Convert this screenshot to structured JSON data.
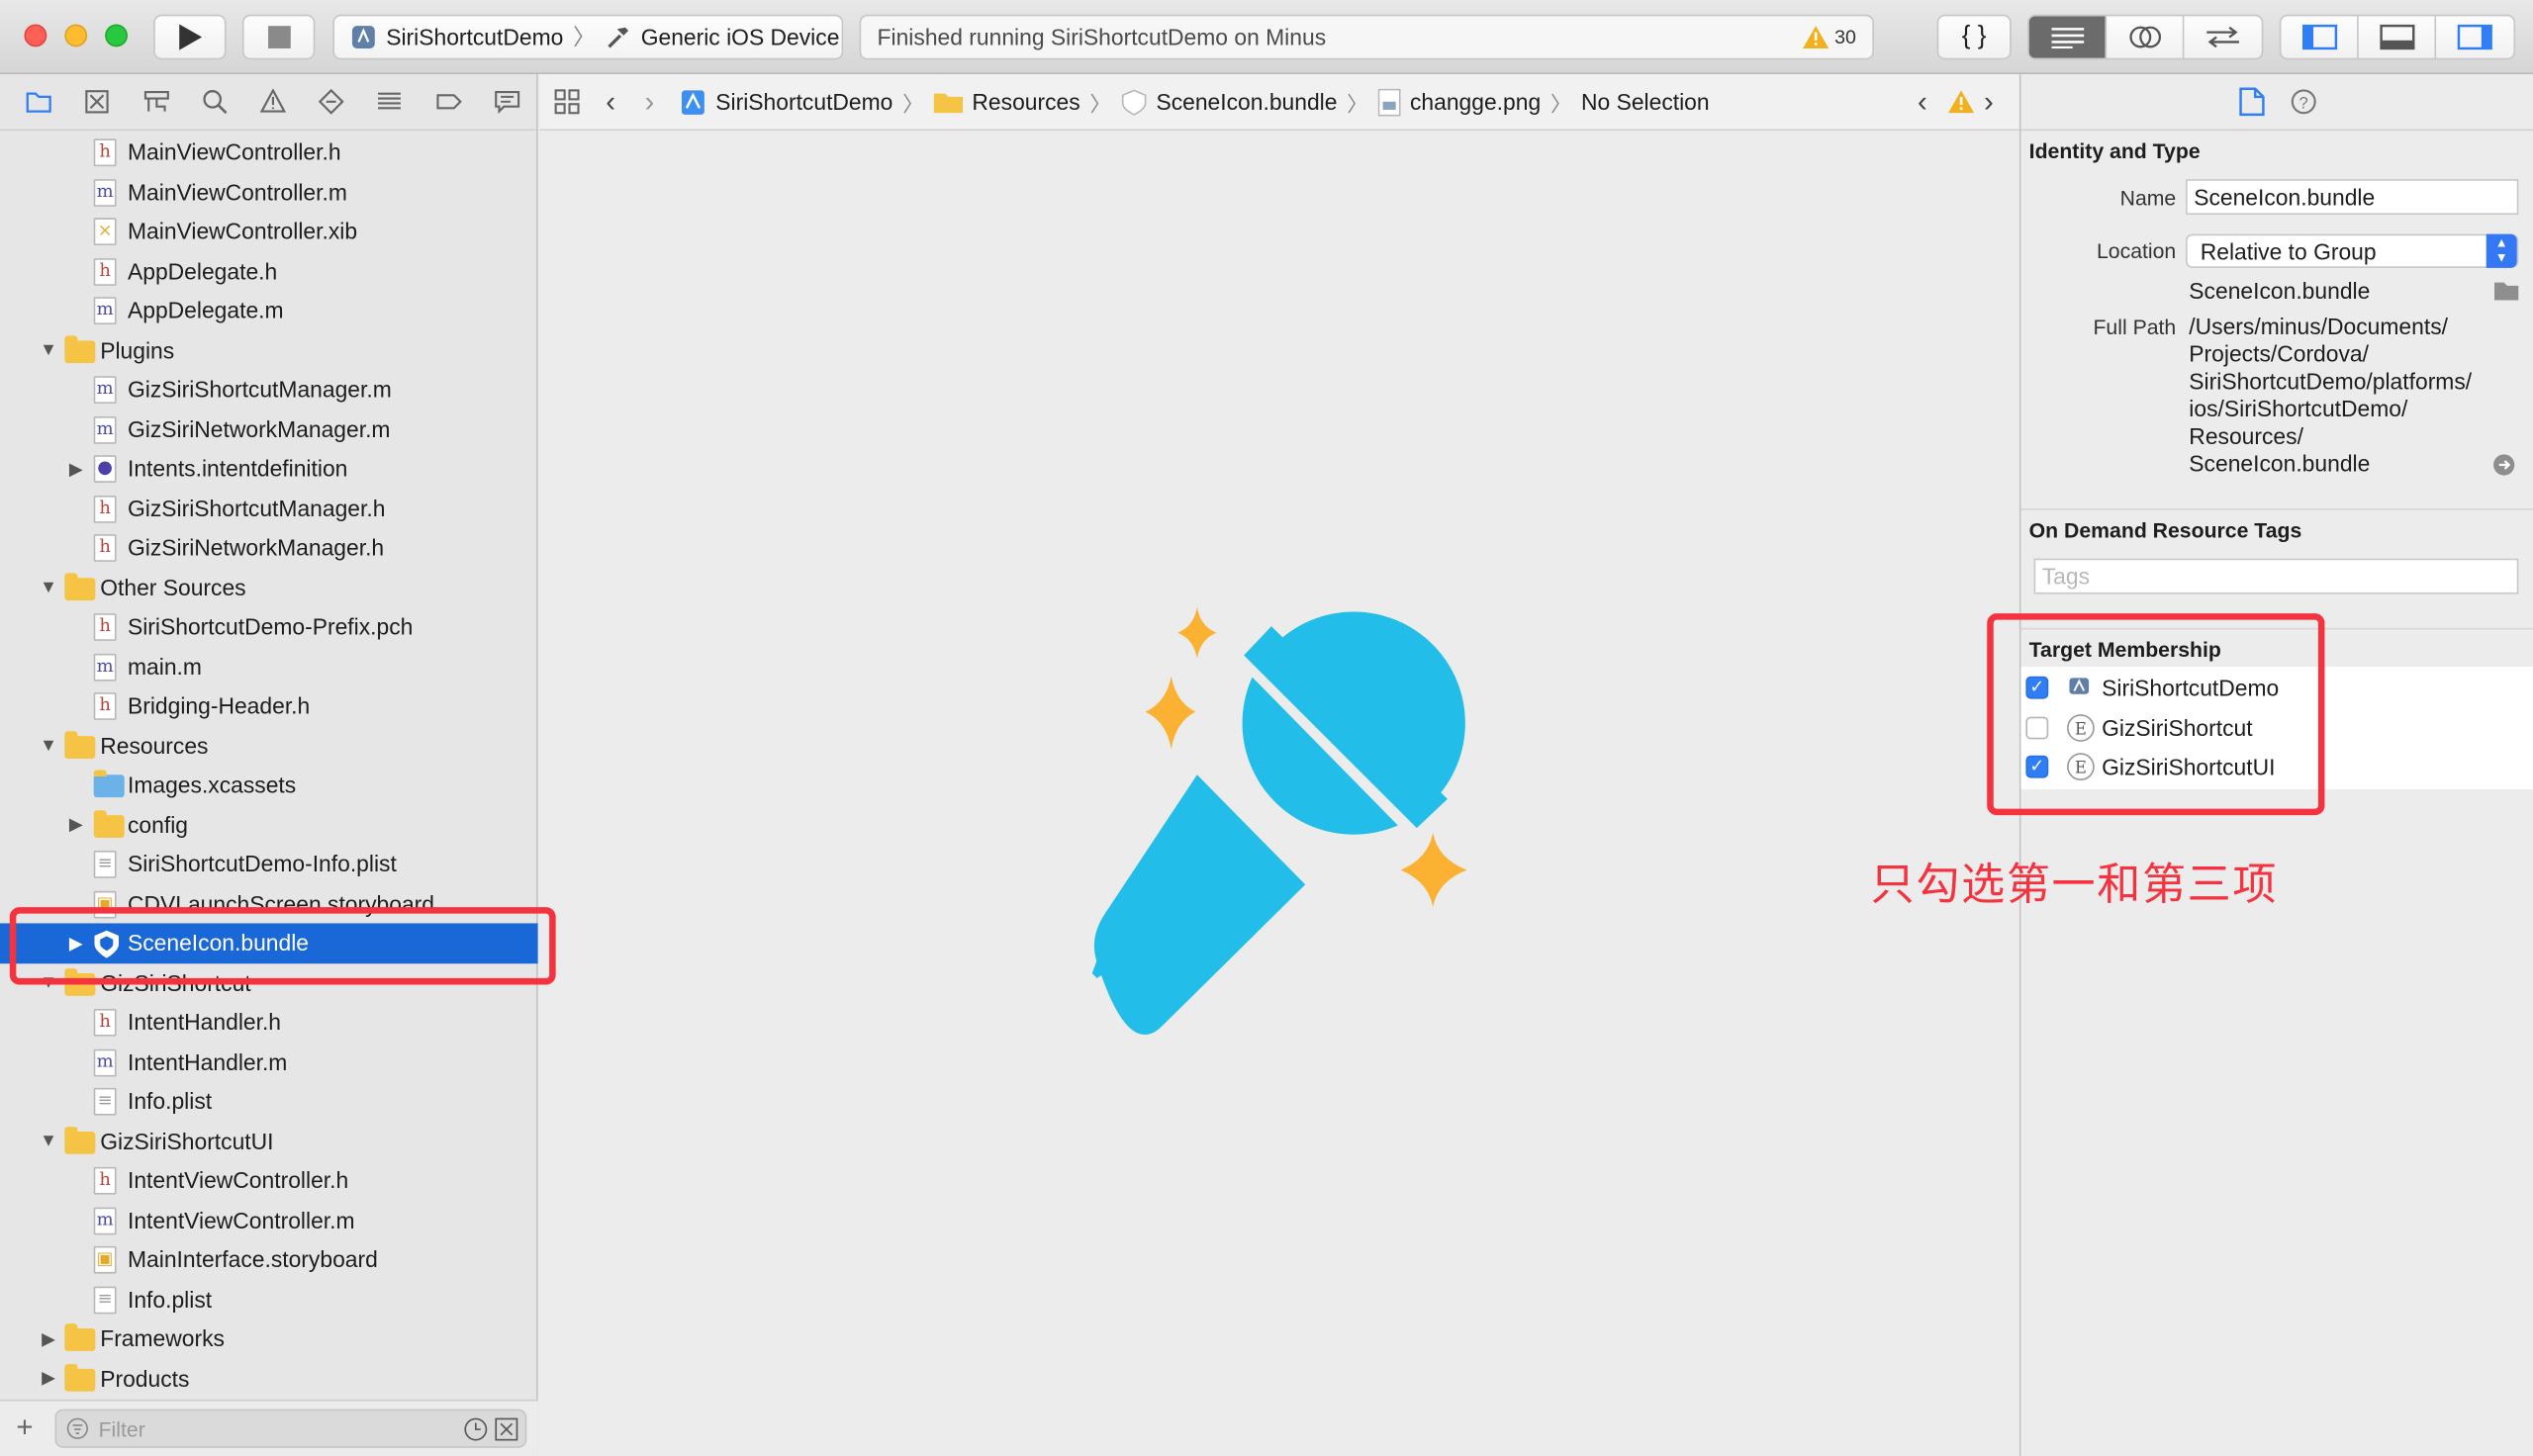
{
  "toolbar": {
    "scheme_target": "SiriShortcutDemo",
    "scheme_device": "Generic iOS Device",
    "status_text": "Finished running SiriShortcutDemo on Minus",
    "warning_count": "30"
  },
  "navigator": {
    "tab_icons": [
      "folder-icon",
      "source-control-icon",
      "symbol-icon",
      "search-icon",
      "issue-icon",
      "test-icon",
      "debug-icon",
      "breakpoint-icon",
      "report-icon"
    ],
    "items": [
      {
        "label": "MainViewController.h",
        "kind": "h",
        "indent": 2
      },
      {
        "label": "MainViewController.m",
        "kind": "m",
        "indent": 2
      },
      {
        "label": "MainViewController.xib",
        "kind": "xib",
        "indent": 2
      },
      {
        "label": "AppDelegate.h",
        "kind": "h",
        "indent": 2
      },
      {
        "label": "AppDelegate.m",
        "kind": "m",
        "indent": 2
      },
      {
        "label": "Plugins",
        "kind": "folder",
        "indent": 1,
        "expanded": true
      },
      {
        "label": "GizSiriShortcutManager.m",
        "kind": "m",
        "indent": 2
      },
      {
        "label": "GizSiriNetworkManager.m",
        "kind": "m",
        "indent": 2
      },
      {
        "label": "Intents.intentdefinition",
        "kind": "intent",
        "indent": 2,
        "collapsed": true
      },
      {
        "label": "GizSiriShortcutManager.h",
        "kind": "h",
        "indent": 2
      },
      {
        "label": "GizSiriNetworkManager.h",
        "kind": "h",
        "indent": 2
      },
      {
        "label": "Other Sources",
        "kind": "folder",
        "indent": 1,
        "expanded": true
      },
      {
        "label": "SiriShortcutDemo-Prefix.pch",
        "kind": "h",
        "indent": 2
      },
      {
        "label": "main.m",
        "kind": "m",
        "indent": 2
      },
      {
        "label": "Bridging-Header.h",
        "kind": "h",
        "indent": 2
      },
      {
        "label": "Resources",
        "kind": "folder",
        "indent": 1,
        "expanded": true
      },
      {
        "label": "Images.xcassets",
        "kind": "assets",
        "indent": 2
      },
      {
        "label": "config",
        "kind": "folder",
        "indent": 2,
        "collapsed": true
      },
      {
        "label": "SiriShortcutDemo-Info.plist",
        "kind": "plist",
        "indent": 2
      },
      {
        "label": "CDVLaunchScreen.storyboard",
        "kind": "storyboard",
        "indent": 2
      },
      {
        "label": "SceneIcon.bundle",
        "kind": "bundle",
        "indent": 2,
        "collapsed": true,
        "selected": true
      },
      {
        "label": "GizSiriShortcut",
        "kind": "folder",
        "indent": 1,
        "expanded": true
      },
      {
        "label": "IntentHandler.h",
        "kind": "h",
        "indent": 2
      },
      {
        "label": "IntentHandler.m",
        "kind": "m",
        "indent": 2
      },
      {
        "label": "Info.plist",
        "kind": "plist",
        "indent": 2
      },
      {
        "label": "GizSiriShortcutUI",
        "kind": "folder",
        "indent": 1,
        "expanded": true
      },
      {
        "label": "IntentViewController.h",
        "kind": "h",
        "indent": 2
      },
      {
        "label": "IntentViewController.m",
        "kind": "m",
        "indent": 2
      },
      {
        "label": "MainInterface.storyboard",
        "kind": "storyboard",
        "indent": 2
      },
      {
        "label": "Info.plist",
        "kind": "plist",
        "indent": 2
      },
      {
        "label": "Frameworks",
        "kind": "folder",
        "indent": 1,
        "collapsed": true
      },
      {
        "label": "Products",
        "kind": "folder",
        "indent": 1,
        "collapsed": true
      }
    ],
    "filter_placeholder": "Filter"
  },
  "jumpbar": {
    "crumbs": [
      "SiriShortcutDemo",
      "Resources",
      "SceneIcon.bundle",
      "changge.png",
      "No Selection"
    ]
  },
  "editor": {
    "image_colors": {
      "mic": "#22bde9",
      "sparkle": "#fbb233"
    }
  },
  "inspector": {
    "identity_title": "Identity and Type",
    "name_label": "Name",
    "name_value": "SceneIcon.bundle",
    "location_label": "Location",
    "location_value": "Relative to Group",
    "location_file": "SceneIcon.bundle",
    "full_path_label": "Full Path",
    "full_path_lines": [
      "/Users/minus/Documents/",
      "Projects/Cordova/",
      "SiriShortcutDemo/platforms/",
      "ios/SiriShortcutDemo/",
      "Resources/",
      "SceneIcon.bundle"
    ],
    "tags_title": "On Demand Resource Tags",
    "tags_placeholder": "Tags",
    "membership_title": "Target Membership",
    "targets": [
      {
        "name": "SiriShortcutDemo",
        "checked": true,
        "icon": "app-icon"
      },
      {
        "name": "GizSiriShortcut",
        "checked": false,
        "icon": "extension-icon"
      },
      {
        "name": "GizSiriShortcutUI",
        "checked": true,
        "icon": "extension-icon"
      }
    ]
  },
  "annotation": {
    "text": "只勾选第一和第三项",
    "color": "#f5333f"
  }
}
